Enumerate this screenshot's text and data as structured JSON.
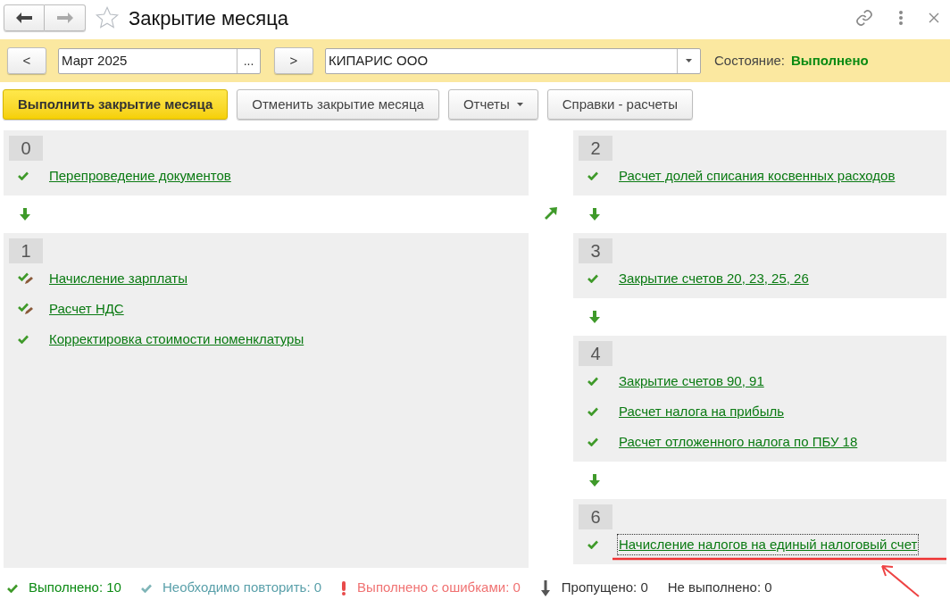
{
  "window": {
    "title": "Закрытие месяца"
  },
  "period": {
    "prev": "<",
    "value": "Март 2025",
    "choose": "...",
    "next": ">"
  },
  "organization": {
    "value": "КИПАРИС ООО"
  },
  "state": {
    "label": "Состояние:",
    "value": "Выполнено"
  },
  "actions": [
    {
      "label": "Выполнить закрытие месяца",
      "kind": "primary"
    },
    {
      "label": "Отменить закрытие месяца",
      "kind": "plain"
    },
    {
      "label": "Отчеты",
      "kind": "menu"
    },
    {
      "label": "Справки - расчеты",
      "kind": "plain"
    }
  ],
  "left_stages": [
    {
      "number": "0",
      "items": [
        {
          "label": "Перепроведение документов",
          "kind": "done",
          "focused": false
        }
      ]
    },
    {
      "number": "1",
      "items": [
        {
          "label": "Начисление зарплаты",
          "kind": "edited",
          "focused": false
        },
        {
          "label": "Расчет НДС",
          "kind": "edited",
          "focused": false
        },
        {
          "label": "Корректировка стоимости номенклатуры",
          "kind": "done",
          "focused": false
        }
      ]
    }
  ],
  "right_stages": [
    {
      "number": "2",
      "items": [
        {
          "label": "Расчет долей списания косвенных расходов",
          "kind": "done",
          "focused": false
        }
      ]
    },
    {
      "number": "3",
      "items": [
        {
          "label": "Закрытие счетов 20, 23, 25, 26",
          "kind": "done",
          "focused": false
        }
      ]
    },
    {
      "number": "4",
      "items": [
        {
          "label": "Закрытие счетов 90, 91",
          "kind": "done",
          "focused": false
        },
        {
          "label": "Расчет налога на прибыль",
          "kind": "done",
          "focused": false
        },
        {
          "label": "Расчет отложенного налога по ПБУ 18",
          "kind": "done",
          "focused": false
        }
      ]
    },
    {
      "number": "6",
      "items": [
        {
          "label": "Начисление налогов на единый налоговый счет",
          "kind": "done",
          "focused": true
        }
      ]
    }
  ],
  "legend": [
    {
      "label": "Выполнено: 10",
      "kind": "done"
    },
    {
      "label": "Необходимо повторить: 0",
      "kind": "repeat"
    },
    {
      "label": "Выполнено с ошибками: 0",
      "kind": "error"
    },
    {
      "label": "Пропущено: 0",
      "kind": "skipped"
    },
    {
      "label": "Не выполнено: 0",
      "kind": "not_done"
    }
  ]
}
